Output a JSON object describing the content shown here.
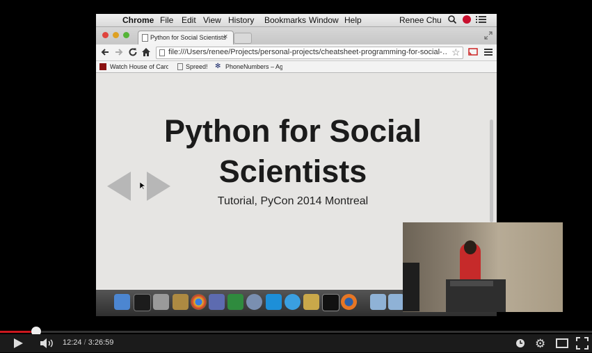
{
  "menubar": {
    "app": "Chrome",
    "menus": [
      "File",
      "Edit",
      "View",
      "History",
      "Bookmarks",
      "Window",
      "Help"
    ],
    "user": "Renee Chu"
  },
  "tab": {
    "title": "Python for Social Scientists"
  },
  "omnibox": {
    "url": "file:///Users/renee/Projects/personal-projects/cheatsheet-programming-for-social-…"
  },
  "bookmarks": [
    "Watch House of Card",
    "Spreed!",
    "PhoneNumbers – Ag"
  ],
  "slide": {
    "title_line1": "Python for Social",
    "title_line2": "Scientists",
    "subtitle": "Tutorial, PyCon 2014 Montreal"
  },
  "player": {
    "current_time": "12:24",
    "separator": " / ",
    "duration": "3:26:59",
    "progress": 0.06,
    "colors": {
      "progress": "#cc181e"
    }
  },
  "icons": [
    "apple-icon",
    "search-icon",
    "notification-icon",
    "list-icon",
    "back-icon",
    "forward-icon",
    "reload-icon",
    "home-icon",
    "star-icon",
    "cast-icon",
    "menu-icon",
    "prev-slide-icon",
    "next-slide-icon",
    "play-icon",
    "volume-icon",
    "watch-later-icon",
    "settings-icon",
    "theater-icon",
    "fullscreen-icon"
  ]
}
